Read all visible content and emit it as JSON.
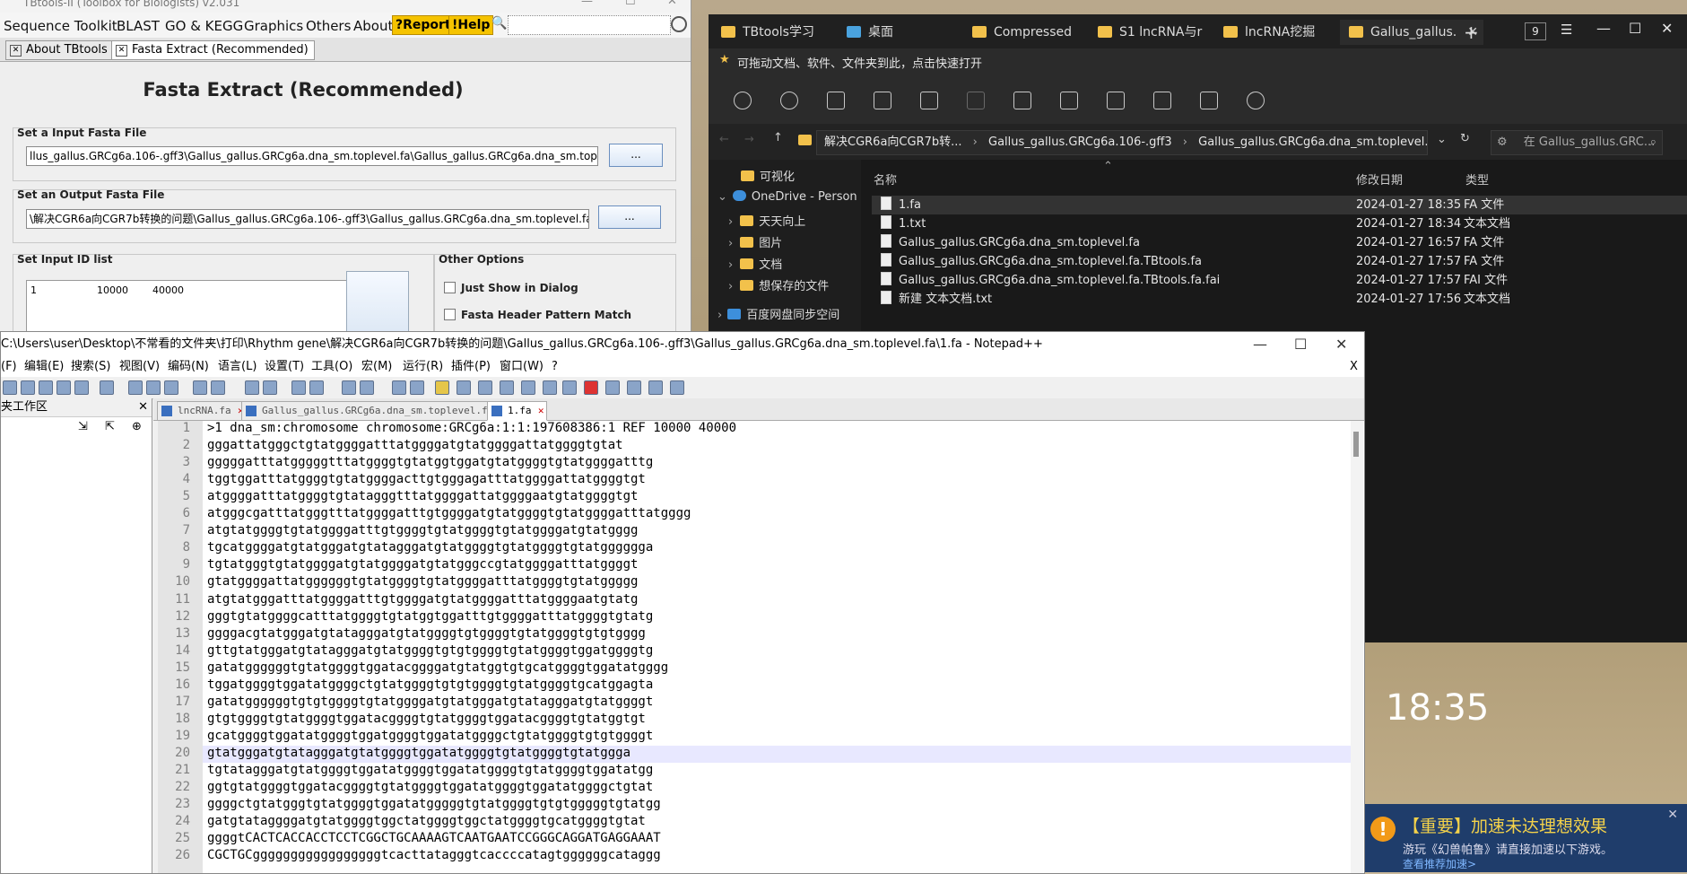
{
  "tbtools": {
    "title": "TBtools-II (Toolbox for Biologists) v2.031",
    "menu": [
      "Sequence Toolkit",
      "BLAST",
      "GO & KEGG",
      "Graphics",
      "Others",
      "About"
    ],
    "report_btn": "?Report",
    "help_btn": "!Help",
    "tabs": [
      "About TBtools",
      "Fasta Extract (Recommended)"
    ],
    "heading": "Fasta Extract (Recommended)",
    "input_label": "Set a Input Fasta File",
    "input_value": "llus_gallus.GRCg6a.106-.gff3\\Gallus_gallus.GRCg6a.dna_sm.toplevel.fa\\Gallus_gallus.GRCg6a.dna_sm.toplevel.fa",
    "output_label": "Set an Output Fasta File",
    "output_value": "\\解决CGR6a向CGR7b转换的问题\\Gallus_gallus.GRCg6a.106-.gff3\\Gallus_gallus.GRCg6a.dna_sm.toplevel.fa\\1.fa",
    "browse": "...",
    "idlist_label": "Set Input ID list",
    "idlist_value": [
      "1",
      "10000",
      "40000"
    ],
    "options_label": "Other Options",
    "opt1": "Just Show in Dialog",
    "opt2": "Fasta Header Pattern Match"
  },
  "explorer": {
    "tabs": [
      "TBtools学习",
      "桌面",
      "Compressed",
      "S1 lncRNA与r",
      "lncRNA挖掘",
      "Gallus_gallus."
    ],
    "tab_count": "9",
    "quick_access": "可拖动文档、软件、文件夹到此，点击快速打开",
    "breadcrumbs": [
      "解决CGR6a向CGR7b转...",
      "Gallus_gallus.GRCg6a.106-.gff3",
      "Gallus_gallus.GRCg6a.dna_sm.toplevel.fa"
    ],
    "search_placeholder": "在 Gallus_gallus.GRC...",
    "nav": [
      "可视化",
      "OneDrive - Person",
      "天天向上",
      "图片",
      "文档",
      "想保存的文件",
      "百度网盘同步空间"
    ],
    "columns": {
      "name": "名称",
      "date": "修改日期",
      "type": "类型"
    },
    "files": [
      {
        "name": "1.fa",
        "date": "2024-01-27 18:35",
        "type": "FA 文件"
      },
      {
        "name": "1.txt",
        "date": "2024-01-27 18:34",
        "type": "文本文档"
      },
      {
        "name": "Gallus_gallus.GRCg6a.dna_sm.toplevel.fa",
        "date": "2024-01-27 16:57",
        "type": "FA 文件"
      },
      {
        "name": "Gallus_gallus.GRCg6a.dna_sm.toplevel.fa.TBtools.fa",
        "date": "2024-01-27 17:57",
        "type": "FA 文件"
      },
      {
        "name": "Gallus_gallus.GRCg6a.dna_sm.toplevel.fa.TBtools.fa.fai",
        "date": "2024-01-27 17:57",
        "type": "FAI 文件"
      },
      {
        "name": "新建 文本文档.txt",
        "date": "2024-01-27 17:56",
        "type": "文本文档"
      }
    ]
  },
  "npp": {
    "title": "C:\\Users\\user\\Desktop\\不常看的文件夹\\打印\\Rhythm gene\\解决CGR6a向CGR7b转换的问题\\Gallus_gallus.GRCg6a.106-.gff3\\Gallus_gallus.GRCg6a.dna_sm.toplevel.fa\\1.fa - Notepad++",
    "menu": [
      "(F)",
      "编辑(E)",
      "搜索(S)",
      "视图(V)",
      "编码(N)",
      "语言(L)",
      "设置(T)",
      "工具(O)",
      "宏(M)",
      "运行(R)",
      "插件(P)",
      "窗口(W)",
      "?"
    ],
    "workspace": "夹工作区",
    "tabs": [
      "lncRNA.fa",
      "Gallus_gallus.GRCg6a.dna_sm.toplevel.fa",
      "1.fa"
    ],
    "lines": [
      ">1 dna_sm:chromosome chromosome:GRCg6a:1:1:197608386:1 REF 10000 40000",
      "gggattatgggctgtatggggatttatggggatgtatggggattatggggtgtat",
      "gggggatttatgggggtttatggggtgtatggtggatgtatggggtgtatggggatttg",
      "tggtggatttatggggtgtatggggacttgtgggagatttatggggattatggggtgt",
      "atggggatttatggggtgtatagggtttatggggattatggggaatgtatggggtgt",
      "atgggcgatttatgggtttatggggatttgtggggatgtatggggtgtatggggatttatgggg",
      "atgtatggggtgtatggggatttgtggggtgtatggggtgtatggggatgtatgggg",
      "tgcatggggatgtatgggatgtatagggatgtatggggtgtatggggtgtatgggggga",
      "tgtatgggtgtatggggatgtatggggatgtatgggccgtatggggatttatggggt",
      "gtatggggattatggggggtgtatggggtgtatggggatttatggggtgtatggggg",
      "atgtatgggatttatggggatttgtggggatgtatggggatttatggggaatgtatg",
      "gggtgtatggggcatttatggggtgtatggtggatttgtggggatttatggggtgtatg",
      "ggggacgtatgggatgtatagggatgtatggggtgtggggtgtatggggtgtgtgggg",
      "gttgtatgggatgtatagggatgtatggggtgtgtggggtgtatggggtggatggggtg",
      "gatatggggggtgtatggggtggatacggggatgtatggtgtgcatggggtggatatgggg",
      "tggatggggtggatatggggctgtatggggtgtgtggggtgtatggggtgcatggagta",
      "gatatggggggtgtgtggggtgtatggggatgtatgggatgtatagggatgtatggggt",
      "gtgtggggtgtatggggtggatacggggtgtatggggtggatacggggtgtatggtgt",
      "gcatggggtggatatggggtggatggggtggatatggggctgtatggggtgtgtggggt",
      "gtatgggatgtatagggatgtatggggtggatatggggtgtatggggtgtatggga",
      "tgtatagggatgtatggggtggatatggggtggatatggggtgtatggggtggatatgg",
      "ggtgtatggggtggatacggggtgtatggggtggatatggggtggatatggggctgtat",
      "ggggctgtatgggtgtatggggtggatatgggggtgtatggggtgtgtgggggtgtatgg",
      "gatgtataggggatgtatggggtggctatggggtggctatggggtgcatggggtgtat",
      "ggggtCACTCACCACCTCCTCGGCTGCAAAAGTCAATGAATCCGGGCAGGATGAGGAAAT",
      "CGCTGCgggggggggggggggggtcacttatagggtcaccccatagtggggggcataggg"
    ]
  },
  "desktop": {
    "clock": "18:35",
    "notify_title": "【重要】加速未达理想效果",
    "notify_sub": "游玩《幻兽帕鲁》请直接加速以下游戏。",
    "notify_link": "查看推荐加速>"
  }
}
